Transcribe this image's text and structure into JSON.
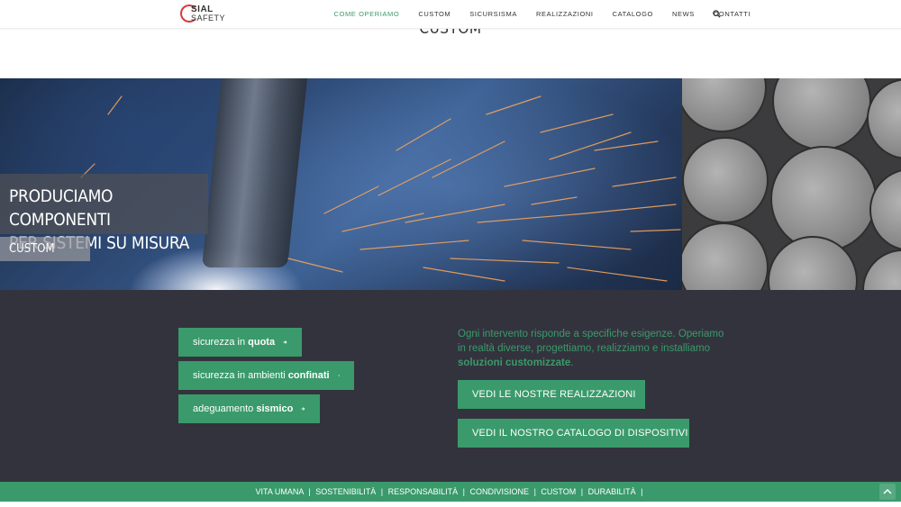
{
  "brand": {
    "logo_line1": "SIAL",
    "logo_line2": "SAFETY",
    "accent": "#3a9a6b",
    "logo_red": "#d63a3a"
  },
  "nav": {
    "items": [
      "COME OPERIAMO",
      "CUSTOM",
      "SICURSISMA",
      "REALIZZAZIONI",
      "CATALOGO",
      "NEWS",
      "CONTATTI"
    ],
    "active": "COME OPERIAMO",
    "search_icon": "search-icon"
  },
  "section_title": "CUSTOM",
  "hero": {
    "heading_line1": "PRODUCIAMO COMPONENTI",
    "heading_line2": "PER SISTEMI SU MISURA",
    "tag": "CUSTOM"
  },
  "left_buttons": [
    {
      "pre": "sicurezza in ",
      "bold": "quota"
    },
    {
      "pre": "sicurezza in ambienti ",
      "bold": "confinati"
    },
    {
      "pre": "adeguamento ",
      "bold": "sismico"
    }
  ],
  "intro": {
    "text": "Ogni intervento risponde a specifiche esigenze. Operiamo in realtà diverse, progettiamo, realizziamo e installiamo ",
    "bold": "soluzioni customizzate",
    "end": "."
  },
  "cta": {
    "realizzazioni": "VEDI LE NOSTRE REALIZZAZIONI",
    "catalogo": "VEDI IL NOSTRO CATALOGO DI DISPOSITIVI"
  },
  "footer": {
    "links": [
      "VITA UMANA",
      "SOSTENIBILITÀ",
      "RESPONSABILITÀ",
      "CONDIVISIONE",
      "CUSTOM",
      "DURABILITÀ"
    ],
    "separator": "|"
  },
  "colors": {
    "dark_bg": "#33333d",
    "button": "#3a9a6b"
  }
}
